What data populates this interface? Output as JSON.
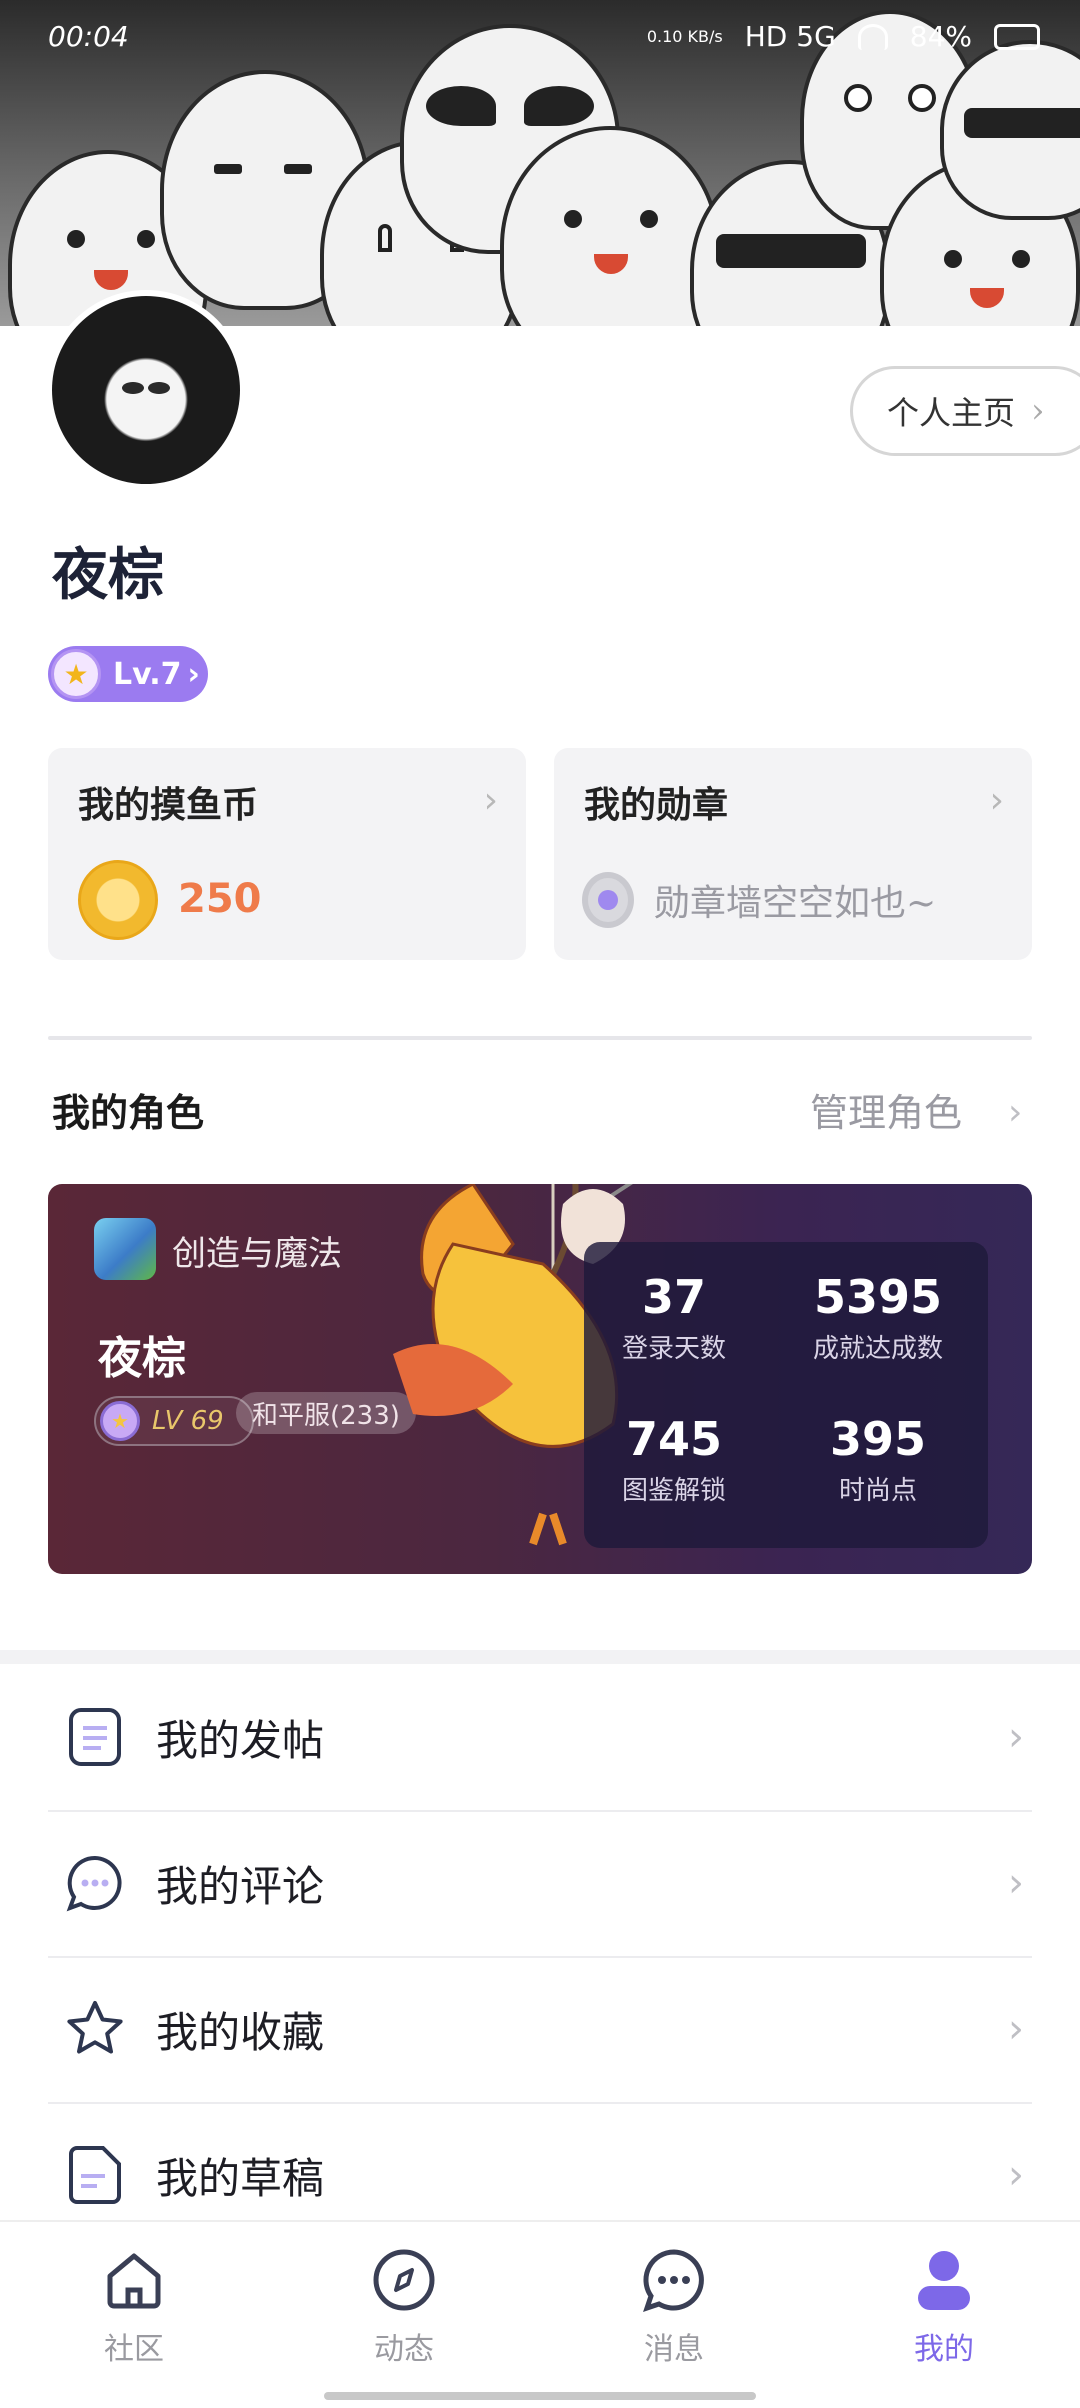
{
  "status_bar": {
    "time": "00:04",
    "speed": "0.10 KB/s",
    "network": "HD 5G",
    "battery": "84%"
  },
  "profile": {
    "username": "夜棕",
    "homepage_button": "个人主页",
    "level": "Lv.7"
  },
  "cards": {
    "coins": {
      "title": "我的摸鱼币",
      "value": "250"
    },
    "medals": {
      "title": "我的勋章",
      "empty_text": "勋章墙空空如也~"
    }
  },
  "roles": {
    "title": "我的角色",
    "manage": "管理角色",
    "game_name": "创造与魔法",
    "character_name": "夜棕",
    "character_level": "LV 69",
    "server": "和平服(233)",
    "stats": [
      {
        "value": "37",
        "label": "登录天数"
      },
      {
        "value": "5395",
        "label": "成就达成数"
      },
      {
        "value": "745",
        "label": "图鉴解锁"
      },
      {
        "value": "395",
        "label": "时尚点"
      }
    ]
  },
  "menu": [
    {
      "label": "我的发帖",
      "icon": "document-icon"
    },
    {
      "label": "我的评论",
      "icon": "comment-icon"
    },
    {
      "label": "我的收藏",
      "icon": "star-icon"
    },
    {
      "label": "我的草稿",
      "icon": "draft-icon"
    }
  ],
  "tabs": [
    {
      "label": "社区",
      "icon": "home-icon"
    },
    {
      "label": "动态",
      "icon": "compass-icon"
    },
    {
      "label": "消息",
      "icon": "message-icon"
    },
    {
      "label": "我的",
      "icon": "user-icon",
      "active": true
    }
  ],
  "colors": {
    "accent": "#7d68e8",
    "level_badge": "#9b7bf0",
    "coin_value": "#ef7b4a",
    "role_card_start": "#5a2737",
    "role_card_end": "#352857"
  }
}
